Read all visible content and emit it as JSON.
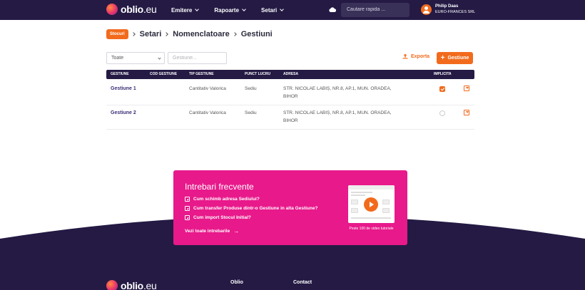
{
  "nav": {
    "logo_bold": "oblio",
    "logo_suffix": ".eu",
    "menu": [
      {
        "label": "Emitere"
      },
      {
        "label": "Rapoarte"
      },
      {
        "label": "Setari"
      }
    ],
    "search_placeholder": "Cautare rapida ...",
    "user_name": "Philip Daas",
    "user_company": "EURO-FRANCES SRL"
  },
  "breadcrumb": {
    "badge": "Stocuri",
    "items": [
      "Setari",
      "Nomenclatoare",
      "Gestiuni"
    ]
  },
  "filters": {
    "select_value": "Toate",
    "search_placeholder": "Gestiune..."
  },
  "actions": {
    "export_label": "Exporta",
    "add_label": "Gestiune"
  },
  "table": {
    "columns": [
      "GESTIUNE",
      "COD GESTIUNE",
      "TIP GESTIUNE",
      "PUNCT LUCRU",
      "ADRESA",
      "IMPLICITA"
    ],
    "rows": [
      {
        "name": "Gestiune 1",
        "code": "",
        "type": "Cantitativ Valorica",
        "punct": "Sediu",
        "address_line1": "STR. NICOLAE LABIȘ, NR.8, AP.1, MUN. ORADEA,",
        "address_line2": "BIHOR",
        "default": true
      },
      {
        "name": "Gestiune 2",
        "code": "",
        "type": "Cantitativ Valorica",
        "punct": "Sediu",
        "address_line1": "STR. NICOLAE LABIȘ, NR.8, AP.1, MUN. ORADEA,",
        "address_line2": "BIHOR",
        "default": false
      }
    ]
  },
  "faq": {
    "title": "Intrebari frecvente",
    "items": [
      "Cum schimb adresa Sediului?",
      "Cum transfer Produse dintr-o Gestiune in alta Gestiune?",
      "Cum import Stocul Initial?"
    ],
    "link": "Vezi toate intrebarile",
    "video_caption": "Peste 100 de video tutoriale"
  },
  "footer": {
    "columns": [
      "Oblio",
      "Contact"
    ]
  },
  "colors": {
    "brand_dark": "#241a44",
    "accent_orange": "#f26b1d",
    "faq_pink": "#e8198b"
  }
}
